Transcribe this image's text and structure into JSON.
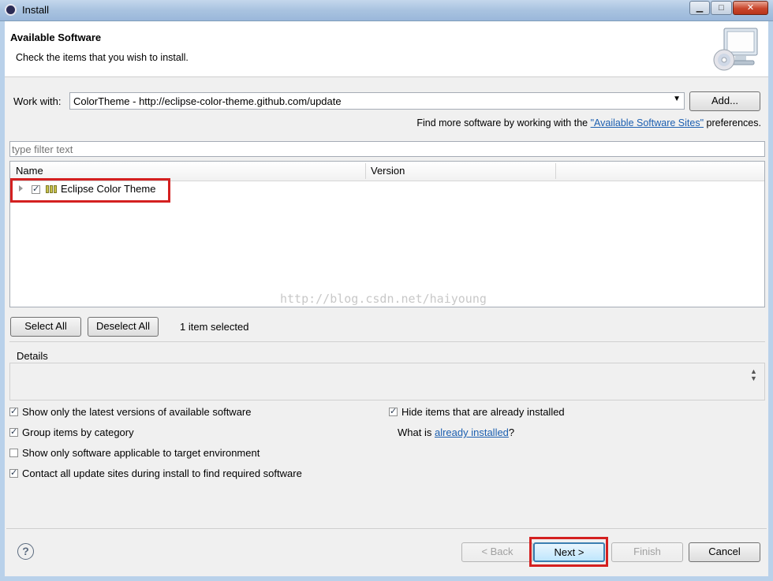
{
  "window": {
    "title": "Install",
    "minimize_glyph": "▁",
    "maximize_glyph": "□",
    "close_glyph": "✕"
  },
  "banner": {
    "title": "Available Software",
    "subtitle": "Check the items that you wish to install.",
    "icon": "monitor-cd-icon"
  },
  "work_with": {
    "label": "Work with:",
    "value": "ColorTheme - http://eclipse-color-theme.github.com/update",
    "add_button": "Add...",
    "find_more_prefix": "Find more software by working with the ",
    "find_more_link": "\"Available Software Sites\"",
    "find_more_suffix": " preferences."
  },
  "filter": {
    "placeholder": "type filter text"
  },
  "tree": {
    "columns": [
      "Name",
      "Version"
    ],
    "rows": [
      {
        "label": "Eclipse Color Theme",
        "version": "",
        "checked": true
      }
    ],
    "watermark": "http://blog.csdn.net/haiyoung"
  },
  "selection": {
    "select_all": "Select All",
    "deselect_all": "Deselect All",
    "count_text": "1 item selected"
  },
  "details": {
    "label": "Details"
  },
  "options": {
    "left": [
      {
        "label": "Show only the latest versions of available software",
        "checked": true
      },
      {
        "label": "Group items by category",
        "checked": true
      },
      {
        "label": "Show only software applicable to target environment",
        "checked": false
      },
      {
        "label": "Contact all update sites during install to find required software",
        "checked": true
      }
    ],
    "right_hide": {
      "label": "Hide items that are already installed",
      "checked": true
    },
    "what_is_prefix": "What is ",
    "what_is_link": "already installed",
    "what_is_suffix": "?"
  },
  "footer": {
    "back": "< Back",
    "next": "Next >",
    "finish": "Finish",
    "cancel": "Cancel",
    "help_glyph": "?"
  },
  "colors": {
    "highlight_box": "#d42020",
    "link": "#1c5fb0"
  }
}
